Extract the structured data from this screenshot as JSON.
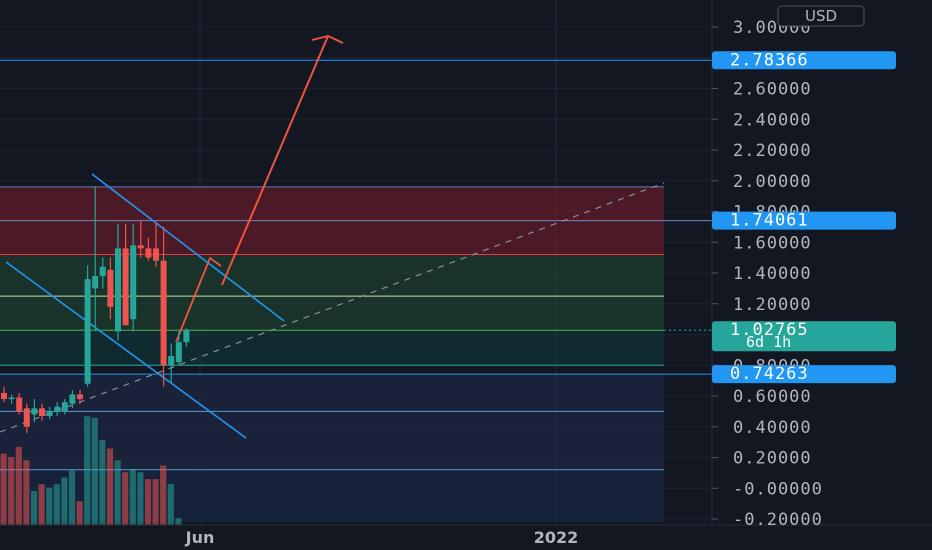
{
  "chart_data": {
    "type": "candlestick",
    "currency": "USD",
    "y_axis": {
      "min": -0.2,
      "max": 3.0,
      "ticks": [
        3.0,
        2.6,
        2.4,
        2.2,
        2.0,
        1.8,
        1.6,
        1.4,
        1.2,
        0.8,
        0.6,
        0.4,
        0.2,
        0.0,
        -0.2
      ],
      "tick_labels": [
        "3.00000",
        "2.60000",
        "2.40000",
        "2.20000",
        "2.00000",
        "1.80000",
        "1.60000",
        "1.40000",
        "1.20000",
        "0.80000",
        "0.60000",
        "0.40000",
        "0.20000",
        "-0.00000",
        "-0.20000"
      ]
    },
    "x_axis": {
      "labels": [
        "Jun",
        "2022"
      ]
    },
    "price_tags": [
      {
        "value": 2.78366,
        "label": "2.78366",
        "color": "#2196f3"
      },
      {
        "value": 1.74061,
        "label": "1.74061",
        "color": "#2196f3"
      },
      {
        "value": 1.02765,
        "label": "1.02765",
        "sub": "6d 1h",
        "color": "#26a69a"
      },
      {
        "value": 0.74263,
        "label": "0.74263",
        "color": "#2196f3"
      }
    ],
    "candles": [
      {
        "o": 0.62,
        "h": 0.66,
        "l": 0.56,
        "c": 0.58
      },
      {
        "o": 0.58,
        "h": 0.61,
        "l": 0.55,
        "c": 0.59
      },
      {
        "o": 0.59,
        "h": 0.62,
        "l": 0.48,
        "c": 0.5
      },
      {
        "o": 0.52,
        "h": 0.55,
        "l": 0.36,
        "c": 0.4
      },
      {
        "o": 0.48,
        "h": 0.58,
        "l": 0.43,
        "c": 0.52
      },
      {
        "o": 0.52,
        "h": 0.55,
        "l": 0.44,
        "c": 0.47
      },
      {
        "o": 0.47,
        "h": 0.53,
        "l": 0.45,
        "c": 0.5
      },
      {
        "o": 0.5,
        "h": 0.56,
        "l": 0.47,
        "c": 0.53
      },
      {
        "o": 0.5,
        "h": 0.58,
        "l": 0.48,
        "c": 0.56
      },
      {
        "o": 0.55,
        "h": 0.64,
        "l": 0.52,
        "c": 0.61
      },
      {
        "o": 0.61,
        "h": 0.64,
        "l": 0.55,
        "c": 0.58
      },
      {
        "o": 0.68,
        "h": 1.45,
        "l": 0.66,
        "c": 1.36
      },
      {
        "o": 1.3,
        "h": 1.96,
        "l": 1.02,
        "c": 1.38
      },
      {
        "o": 1.38,
        "h": 1.5,
        "l": 1.3,
        "c": 1.44
      },
      {
        "o": 1.42,
        "h": 1.5,
        "l": 1.1,
        "c": 1.18
      },
      {
        "o": 1.02,
        "h": 1.72,
        "l": 0.96,
        "c": 1.56
      },
      {
        "o": 1.56,
        "h": 1.72,
        "l": 1.28,
        "c": 1.06
      },
      {
        "o": 1.1,
        "h": 1.72,
        "l": 1.02,
        "c": 1.58
      },
      {
        "o": 1.58,
        "h": 1.74,
        "l": 1.5,
        "c": 1.56
      },
      {
        "o": 1.56,
        "h": 1.63,
        "l": 1.48,
        "c": 1.5
      },
      {
        "o": 1.56,
        "h": 1.73,
        "l": 1.44,
        "c": 1.48
      },
      {
        "o": 1.48,
        "h": 1.7,
        "l": 0.66,
        "c": 0.8
      },
      {
        "o": 0.8,
        "h": 0.94,
        "l": 0.68,
        "c": 0.86
      },
      {
        "o": 0.82,
        "h": 1.02,
        "l": 0.8,
        "c": 0.95
      },
      {
        "o": 0.95,
        "h": 1.04,
        "l": 0.92,
        "c": 1.03
      }
    ],
    "volume": [
      {
        "v": 0.42,
        "dir": "down"
      },
      {
        "v": 0.4,
        "dir": "down"
      },
      {
        "v": 0.46,
        "dir": "down"
      },
      {
        "v": 0.38,
        "dir": "down"
      },
      {
        "v": 0.2,
        "dir": "up"
      },
      {
        "v": 0.24,
        "dir": "down"
      },
      {
        "v": 0.22,
        "dir": "up"
      },
      {
        "v": 0.24,
        "dir": "up"
      },
      {
        "v": 0.28,
        "dir": "up"
      },
      {
        "v": 0.32,
        "dir": "up"
      },
      {
        "v": 0.14,
        "dir": "down"
      },
      {
        "v": 0.64,
        "dir": "up"
      },
      {
        "v": 0.63,
        "dir": "up"
      },
      {
        "v": 0.5,
        "dir": "up"
      },
      {
        "v": 0.45,
        "dir": "down"
      },
      {
        "v": 0.38,
        "dir": "up"
      },
      {
        "v": 0.31,
        "dir": "down"
      },
      {
        "v": 0.33,
        "dir": "up"
      },
      {
        "v": 0.31,
        "dir": "up"
      },
      {
        "v": 0.27,
        "dir": "down"
      },
      {
        "v": 0.27,
        "dir": "down"
      },
      {
        "v": 0.35,
        "dir": "down"
      },
      {
        "v": 0.24,
        "dir": "up"
      },
      {
        "v": 0.04,
        "dir": "up"
      }
    ],
    "zones": [
      {
        "from": 1.52,
        "to": 1.96,
        "color": "#7b1e2a"
      },
      {
        "from": 1.02,
        "to": 1.52,
        "color": "#1f4a33"
      },
      {
        "from": 0.8,
        "to": 1.02,
        "color": "#0e3d3d"
      },
      {
        "from": 0.12,
        "to": 0.74,
        "color": "#1f2b4a"
      },
      {
        "from": -0.22,
        "to": 0.12,
        "color": "#172c4d"
      }
    ],
    "levels": [
      {
        "value": 2.78366,
        "color": "#2196f3"
      },
      {
        "value": 1.96,
        "color": "#5c7bbd"
      },
      {
        "value": 1.74061,
        "color": "#6f86c8"
      },
      {
        "value": 1.52,
        "color": "#f23645"
      },
      {
        "value": 1.25,
        "color": "#c5e1a5"
      },
      {
        "value": 1.02765,
        "color": "#4caf50"
      },
      {
        "value": 0.8,
        "color": "#26a69a"
      },
      {
        "value": 0.74263,
        "color": "#2196f3"
      },
      {
        "value": 0.5,
        "color": "#5b9bd5"
      },
      {
        "value": 0.12,
        "color": "#5b9bd5"
      }
    ]
  }
}
